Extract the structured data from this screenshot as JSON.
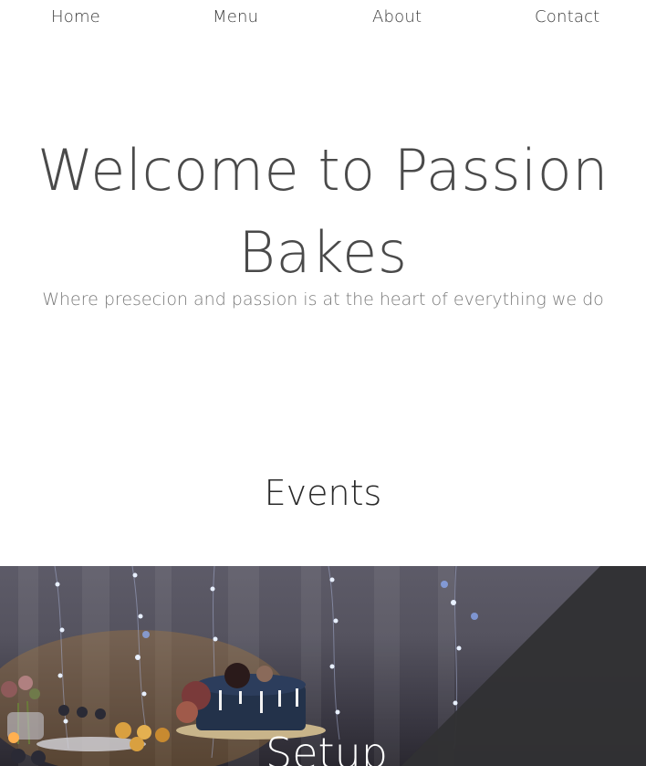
{
  "nav": {
    "items": [
      "Home",
      "Menu",
      "About",
      "Contact"
    ]
  },
  "hero": {
    "title": "Welcome to Passion Bakes",
    "subtitle": "Where presecion and passion is at the heart of everything we do"
  },
  "events": {
    "heading": "Events",
    "card_title": "Setup",
    "image_alt": "Dessert table with a drip cake, cupcakes and fairy lights"
  },
  "colors": {
    "background": "#ffffff",
    "text": "#3c3c3c",
    "overlay": "#333333"
  }
}
